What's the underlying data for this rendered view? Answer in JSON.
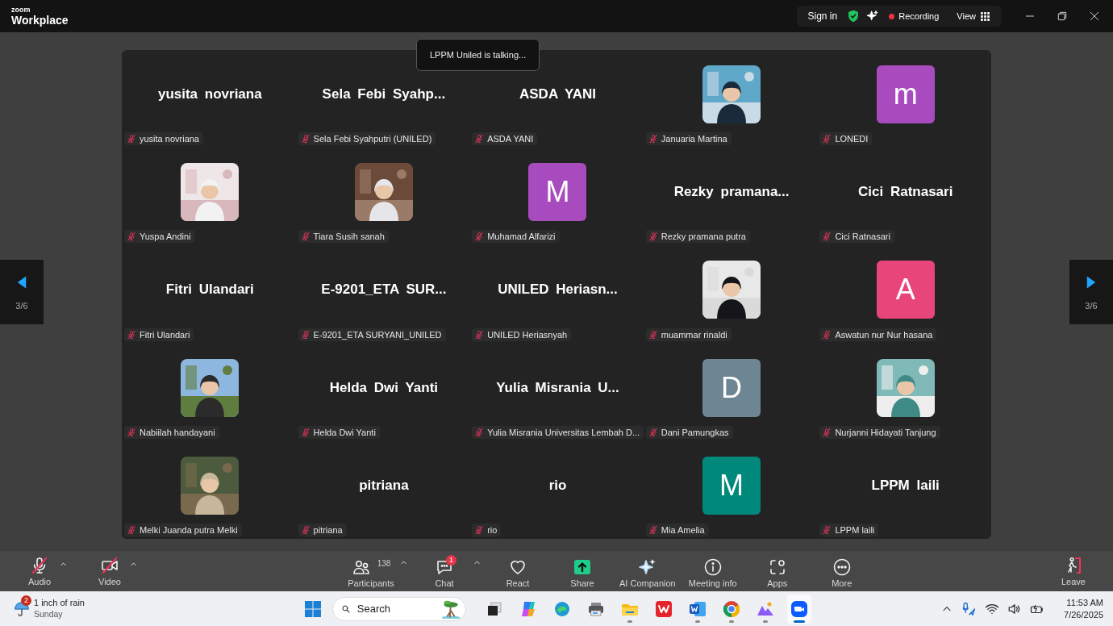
{
  "title_bar": {
    "logo_top": "zoom",
    "logo_bottom": "Workplace",
    "sign_in": "Sign in",
    "recording": {
      "label": "Recording",
      "on": true
    },
    "view": "View"
  },
  "talking_toast": "LPPM Uniled is talking...",
  "pager": {
    "left": "3/6",
    "right": "3/6"
  },
  "tiles": [
    {
      "kind": "name",
      "display": "yusita novriana",
      "label": "yusita novriana",
      "muted": true
    },
    {
      "kind": "name",
      "display": "Sela Febi Syahp...",
      "label": "Sela Febi Syahputri (UNILED)",
      "muted": true
    },
    {
      "kind": "name",
      "display": "ASDA YANI",
      "label": "ASDA YANI",
      "muted": true
    },
    {
      "label": "Januaria Martina",
      "muted": true
    },
    {
      "kind": "initial",
      "display": "m",
      "color": "#a84bbf",
      "label": "LONEDI",
      "muted": true
    },
    {
      "label": "Yuspa Andini",
      "muted": true
    },
    {
      "label": "Tiara Susih sanah",
      "muted": true
    },
    {
      "kind": "initial",
      "display": "M",
      "color": "#a84bbf",
      "label": "Muhamad Alfarizi",
      "muted": true
    },
    {
      "kind": "name",
      "display": "Rezky pramana...",
      "label": "Rezky pramana putra",
      "muted": true
    },
    {
      "kind": "name",
      "display": "Cici Ratnasari",
      "label": "Cici Ratnasari",
      "muted": true
    },
    {
      "kind": "name",
      "display": "Fitri Ulandari",
      "label": "Fitri Ulandari",
      "muted": true
    },
    {
      "kind": "name",
      "display": "E-9201_ETA SUR...",
      "label": "E-9201_ETA SURYANI_UNILED",
      "muted": true
    },
    {
      "kind": "name",
      "display": "UNILED Heriasn...",
      "label": "UNILED Heriasnyah",
      "muted": true
    },
    {
      "label": "muammar rinaldi",
      "muted": true
    },
    {
      "kind": "initial",
      "display": "A",
      "color": "#e8457a",
      "label": "Aswatun nur Nur hasana",
      "muted": true
    },
    {
      "label": "Nabiilah handayani",
      "muted": true
    },
    {
      "kind": "name",
      "display": "Helda Dwi Yanti",
      "label": "Helda Dwi Yanti",
      "muted": true
    },
    {
      "kind": "name",
      "display": "Yulia Misrania U...",
      "label": "Yulia Misrania Universitas Lembah D...",
      "muted": true
    },
    {
      "kind": "initial",
      "display": "D",
      "color": "#6e8593",
      "label": "Dani Pamungkas",
      "muted": true
    },
    {
      "label": "Nurjanni Hidayati Tanjung",
      "muted": true
    },
    {
      "label": "Melki Juanda putra Melki",
      "muted": true
    },
    {
      "kind": "name",
      "display": "pitriana",
      "label": "pitriana",
      "muted": true
    },
    {
      "kind": "name",
      "display": "rio",
      "label": "rio",
      "muted": true
    },
    {
      "kind": "initial",
      "display": "M",
      "color": "#00897b",
      "label": "Mia Amelia",
      "muted": true
    },
    {
      "kind": "name",
      "display": "LPPM laili",
      "label": "LPPM laili",
      "muted": true
    }
  ],
  "toolbar": {
    "left": [
      {
        "kind": "audio",
        "label": "Audio",
        "muted": true
      },
      {
        "kind": "video",
        "label": "Video",
        "muted": true
      }
    ],
    "center": [
      {
        "kind": "participants",
        "label": "Participants",
        "count": "138",
        "caret": true
      },
      {
        "kind": "chat",
        "label": "Chat",
        "badge": "1",
        "caret": true
      },
      {
        "kind": "react",
        "label": "React",
        "caret": false
      },
      {
        "kind": "share",
        "label": "Share",
        "caret": false
      },
      {
        "kind": "ai",
        "label": "AI Companion",
        "caret": false
      },
      {
        "kind": "info",
        "label": "Meeting info",
        "caret": false
      },
      {
        "kind": "apps",
        "label": "Apps",
        "caret": false
      },
      {
        "kind": "more",
        "label": "More",
        "caret": false
      }
    ],
    "leave": "Leave"
  },
  "taskbar": {
    "weather": {
      "badge": "2",
      "title": "1 inch of rain",
      "subtitle": "Sunday"
    },
    "search_placeholder": "Search",
    "apps": [
      {
        "kind": "taskview",
        "running": false,
        "selected": false
      },
      {
        "kind": "copilot",
        "running": false,
        "selected": false
      },
      {
        "kind": "edge",
        "running": false,
        "selected": false
      },
      {
        "kind": "scanner",
        "running": false,
        "selected": false
      },
      {
        "kind": "files",
        "running": true,
        "selected": false
      },
      {
        "kind": "wps",
        "running": false,
        "selected": false
      },
      {
        "kind": "word",
        "running": true,
        "selected": false
      },
      {
        "kind": "chrome",
        "running": true,
        "selected": false
      },
      {
        "kind": "gallery",
        "running": true,
        "selected": false
      },
      {
        "kind": "zoom",
        "running": true,
        "selected": true
      }
    ],
    "time": "11:53 AM",
    "date": "7/26/2025"
  }
}
